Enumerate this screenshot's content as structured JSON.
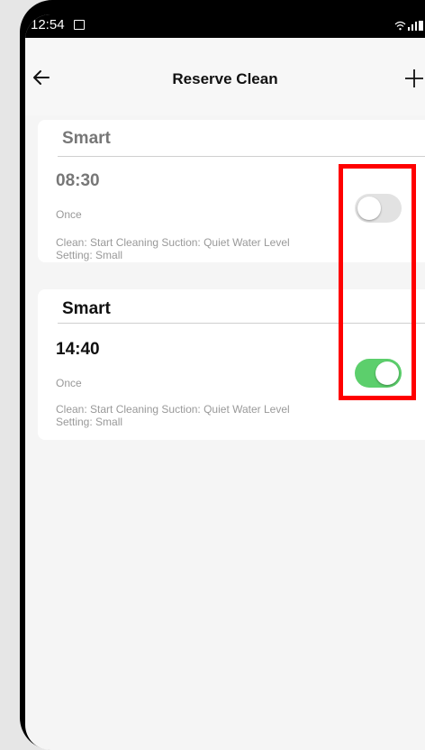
{
  "status_bar": {
    "time": "12:54",
    "icons": [
      "gallery-icon",
      "wifi-icon",
      "signal-icon",
      "battery-icon"
    ]
  },
  "header": {
    "title": "Reserve Clean",
    "back_icon": "arrow-left-icon",
    "add_icon": "plus-icon"
  },
  "schedules": [
    {
      "title": "Smart",
      "time": "08:30",
      "repeat": "Once",
      "details": "Clean: Start Cleaning  Suction: Quiet  Water Level Setting: Small",
      "enabled": false
    },
    {
      "title": "Smart",
      "time": "14:40",
      "repeat": "Once",
      "details": "Clean: Start Cleaning  Suction: Quiet  Water Level Setting: Small",
      "enabled": true
    }
  ],
  "colors": {
    "toggle_on": "#5ccf6c",
    "toggle_off": "#e2e2e2",
    "highlight": "#ff0000"
  }
}
